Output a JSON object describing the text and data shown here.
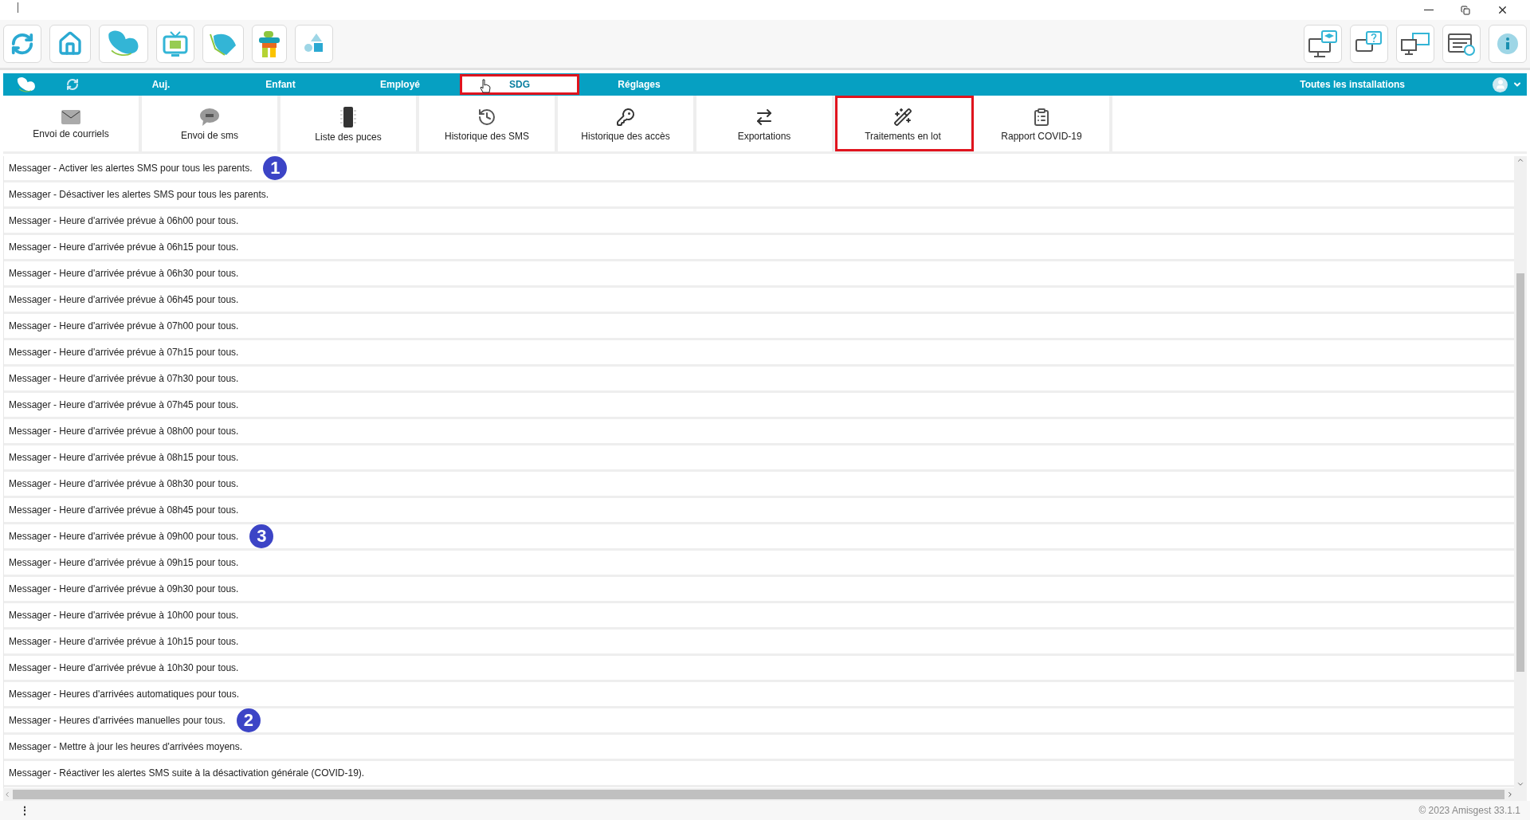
{
  "nav": {
    "items": [
      {
        "label": "Auj.",
        "selected": false,
        "highlighted": false
      },
      {
        "label": "Enfant",
        "selected": false,
        "highlighted": false
      },
      {
        "label": "Employé",
        "selected": false,
        "highlighted": false
      },
      {
        "label": "SDG",
        "selected": true,
        "highlighted": true
      },
      {
        "label": "Réglages",
        "selected": false,
        "highlighted": false
      }
    ],
    "site": "Toutes les installations"
  },
  "subtools": [
    {
      "label": "Envoi de courriels",
      "highlighted": false
    },
    {
      "label": "Envoi de sms",
      "highlighted": false
    },
    {
      "label": "Liste des puces",
      "highlighted": false
    },
    {
      "label": "Historique des SMS",
      "highlighted": false
    },
    {
      "label": "Historique des accès",
      "highlighted": false
    },
    {
      "label": "Exportations",
      "highlighted": false
    },
    {
      "label": "Traitements en lot",
      "highlighted": true
    },
    {
      "label": "Rapport COVID-19",
      "highlighted": false
    }
  ],
  "rows": [
    {
      "text": "Messager - Activer les alertes SMS pour tous les parents.",
      "badge": "1"
    },
    {
      "text": "Messager - Désactiver les alertes SMS pour tous les parents."
    },
    {
      "text": "Messager - Heure d'arrivée prévue à 06h00 pour tous."
    },
    {
      "text": "Messager - Heure d'arrivée prévue à 06h15 pour tous."
    },
    {
      "text": "Messager - Heure d'arrivée prévue à 06h30 pour tous."
    },
    {
      "text": "Messager - Heure d'arrivée prévue à 06h45 pour tous."
    },
    {
      "text": "Messager - Heure d'arrivée prévue à 07h00 pour tous."
    },
    {
      "text": "Messager - Heure d'arrivée prévue à 07h15 pour tous."
    },
    {
      "text": "Messager - Heure d'arrivée prévue à 07h30 pour tous."
    },
    {
      "text": "Messager - Heure d'arrivée prévue à 07h45 pour tous."
    },
    {
      "text": "Messager - Heure d'arrivée prévue à 08h00 pour tous."
    },
    {
      "text": "Messager - Heure d'arrivée prévue à 08h15 pour tous."
    },
    {
      "text": "Messager - Heure d'arrivée prévue à 08h30 pour tous."
    },
    {
      "text": "Messager - Heure d'arrivée prévue à 08h45 pour tous."
    },
    {
      "text": "Messager - Heure d'arrivée prévue à 09h00 pour tous.",
      "badge": "3"
    },
    {
      "text": "Messager - Heure d'arrivée prévue à 09h15 pour tous."
    },
    {
      "text": "Messager - Heure d'arrivée prévue à 09h30 pour tous."
    },
    {
      "text": "Messager - Heure d'arrivée prévue à 10h00 pour tous."
    },
    {
      "text": "Messager - Heure d'arrivée prévue à 10h15 pour tous."
    },
    {
      "text": "Messager - Heure d'arrivée prévue à 10h30 pour tous."
    },
    {
      "text": "Messager - Heures d'arrivées automatiques pour tous."
    },
    {
      "text": "Messager - Heures d'arrivées manuelles pour tous.",
      "badge": "2"
    },
    {
      "text": "Messager - Mettre à jour les heures d'arrivées moyens."
    },
    {
      "text": "Messager - Réactiver les alertes SMS suite à la désactivation générale (COVID-19)."
    }
  ],
  "footer": {
    "menu": "⋮",
    "copyright": "© 2023 Amisgest 33.1.1"
  }
}
